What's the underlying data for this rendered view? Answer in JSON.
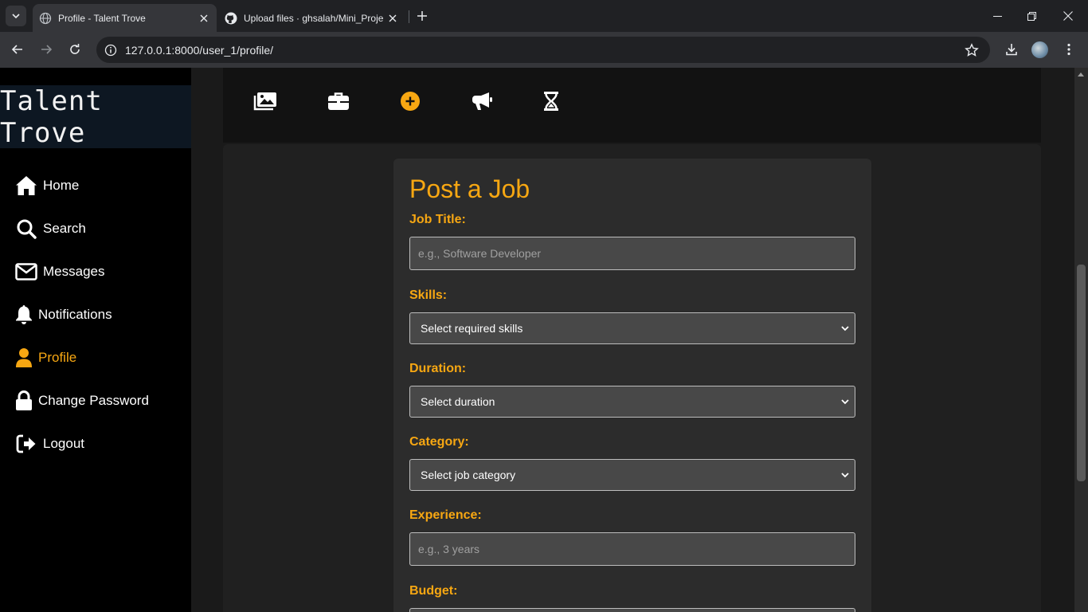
{
  "browser": {
    "tabs": [
      {
        "title": "Profile - Talent Trove",
        "active": true
      },
      {
        "title": "Upload files · ghsalah/Mini_Proje",
        "active": false
      }
    ],
    "url": "127.0.0.1:8000/user_1/profile/"
  },
  "sidebar": {
    "logo": "Talent Trove",
    "items": [
      {
        "label": "Home",
        "icon": "home-icon"
      },
      {
        "label": "Search",
        "icon": "search-icon"
      },
      {
        "label": "Messages",
        "icon": "envelope-icon"
      },
      {
        "label": "Notifications",
        "icon": "bell-icon"
      },
      {
        "label": "Profile",
        "icon": "user-icon",
        "active": true
      },
      {
        "label": "Change Password",
        "icon": "lock-icon"
      },
      {
        "label": "Logout",
        "icon": "logout-icon"
      }
    ]
  },
  "profile_tabs": [
    "images-icon",
    "briefcase-icon",
    "plus-circle-icon",
    "megaphone-icon",
    "hourglass-icon"
  ],
  "form": {
    "title": "Post a Job",
    "job_title_label": "Job Title:",
    "job_title_placeholder": "e.g., Software Developer",
    "skills_label": "Skills:",
    "skills_selected": "Select required skills",
    "duration_label": "Duration:",
    "duration_selected": "Select duration",
    "category_label": "Category:",
    "category_selected": "Select job category",
    "experience_label": "Experience:",
    "experience_placeholder": "e.g., 3 years",
    "budget_label": "Budget:"
  },
  "colors": {
    "accent": "#f7a712",
    "sidebar_bg": "#000000",
    "card_bg": "#2c2c2c"
  }
}
